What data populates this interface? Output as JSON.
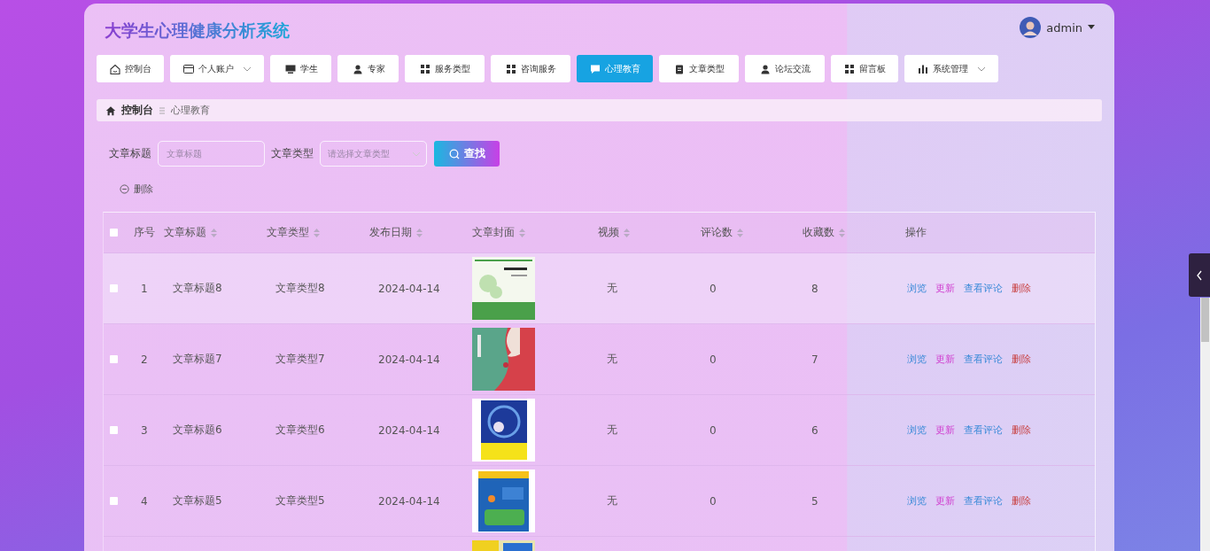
{
  "header": {
    "title": "大学生心理健康分析系统",
    "user": {
      "name": "admin"
    }
  },
  "nav": [
    {
      "label": "控制台",
      "selected": false,
      "has_menu": false
    },
    {
      "label": "个人账户",
      "selected": false,
      "has_menu": true
    },
    {
      "label": "学生",
      "selected": false,
      "has_menu": false
    },
    {
      "label": "专家",
      "selected": false,
      "has_menu": false
    },
    {
      "label": "服务类型",
      "selected": false,
      "has_menu": false
    },
    {
      "label": "咨询服务",
      "selected": false,
      "has_menu": false
    },
    {
      "label": "心理教育",
      "selected": true,
      "has_menu": false
    },
    {
      "label": "文章类型",
      "selected": false,
      "has_menu": false
    },
    {
      "label": "论坛交流",
      "selected": false,
      "has_menu": false
    },
    {
      "label": "留言板",
      "selected": false,
      "has_menu": false
    },
    {
      "label": "系统管理",
      "selected": false,
      "has_menu": true
    }
  ],
  "breadcrumb": [
    "控制台",
    "心理教育"
  ],
  "search": {
    "fields": [
      {
        "label": "文章标题",
        "placeholder": "文章标题",
        "kind": "text"
      },
      {
        "label": "文章类型",
        "placeholder": "请选择文章类型",
        "kind": "select"
      }
    ],
    "button": "查找"
  },
  "delete_button": "删除",
  "table": {
    "header_checked": false,
    "columns": [
      {
        "label": "序号",
        "sortable": false
      },
      {
        "label": "文章标题",
        "sortable": true
      },
      {
        "label": "文章类型",
        "sortable": true
      },
      {
        "label": "发布日期",
        "sortable": true
      },
      {
        "label": "文章封面",
        "sortable": true
      },
      {
        "label": "视频",
        "sortable": true
      },
      {
        "label": "评论数",
        "sortable": true
      },
      {
        "label": "收藏数",
        "sortable": true
      },
      {
        "label": "操作",
        "sortable": false
      }
    ],
    "rows": [
      {
        "hovered": true,
        "checked": false,
        "index": "1",
        "title": "文章标题8",
        "type": "文章类型8",
        "date": "2024-04-14",
        "cover": {
          "kind": "picture"
        },
        "video": "无",
        "comments": "0",
        "favorites": "8",
        "actions": [
          "浏览",
          "更新",
          "查看评论",
          "删除"
        ]
      },
      {
        "hovered": false,
        "checked": false,
        "index": "2",
        "title": "文章标题7",
        "type": "文章类型7",
        "date": "2024-04-14",
        "cover": {
          "kind": "picture"
        },
        "video": "无",
        "comments": "0",
        "favorites": "7",
        "actions": [
          "浏览",
          "更新",
          "查看评论",
          "删除"
        ]
      },
      {
        "hovered": false,
        "checked": false,
        "index": "3",
        "title": "文章标题6",
        "type": "文章类型6",
        "date": "2024-04-14",
        "cover": {
          "kind": "picture"
        },
        "video": "无",
        "comments": "0",
        "favorites": "6",
        "actions": [
          "浏览",
          "更新",
          "查看评论",
          "删除"
        ]
      },
      {
        "hovered": false,
        "checked": false,
        "index": "4",
        "title": "文章标题5",
        "type": "文章类型5",
        "date": "2024-04-14",
        "cover": {
          "kind": "picture"
        },
        "video": "无",
        "comments": "0",
        "favorites": "5",
        "actions": [
          "浏览",
          "更新",
          "查看评论",
          "删除"
        ]
      },
      {
        "hovered": false,
        "cover": {
          "kind": "picture"
        }
      }
    ]
  }
}
